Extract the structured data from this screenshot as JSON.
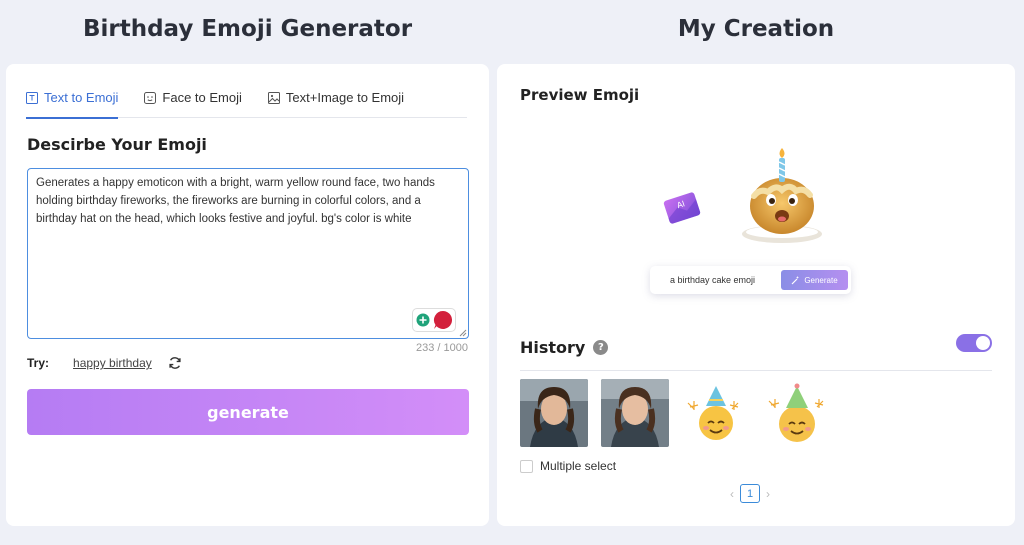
{
  "left_heading": "Birthday Emoji Generator",
  "right_heading": "My Creation",
  "tabs": [
    {
      "label": "Text to Emoji",
      "active": true,
      "icon": "text-box-icon"
    },
    {
      "label": "Face to Emoji",
      "active": false,
      "icon": "face-icon"
    },
    {
      "label": "Text+Image to Emoji",
      "active": false,
      "icon": "image-icon"
    }
  ],
  "describe": {
    "title": "Descirbe Your Emoji",
    "value": "Generates a happy emoticon with a bright, warm yellow round face, two hands holding birthday fireworks, the fireworks are burning in colorful colors, and a birthday hat on the head, which looks festive and joyful. bg's color is white",
    "char_count": "233 / 1000"
  },
  "try": {
    "label": "Try:",
    "suggestion": "happy birthday"
  },
  "generate_label": "generate",
  "preview": {
    "title": "Preview Emoji",
    "ai_badge": "AI",
    "mini_prompt": "a birthday cake emoji",
    "mini_generate": "Generate"
  },
  "history": {
    "title": "History",
    "help": "?",
    "toggle_on": true,
    "multiple_select": "Multiple select",
    "page": "1"
  },
  "colors": {
    "accent_blue": "#3b6fd4",
    "generate_gradient_start": "#b57cf3",
    "generate_gradient_end": "#d38ef8",
    "toggle": "#8a70e6"
  }
}
